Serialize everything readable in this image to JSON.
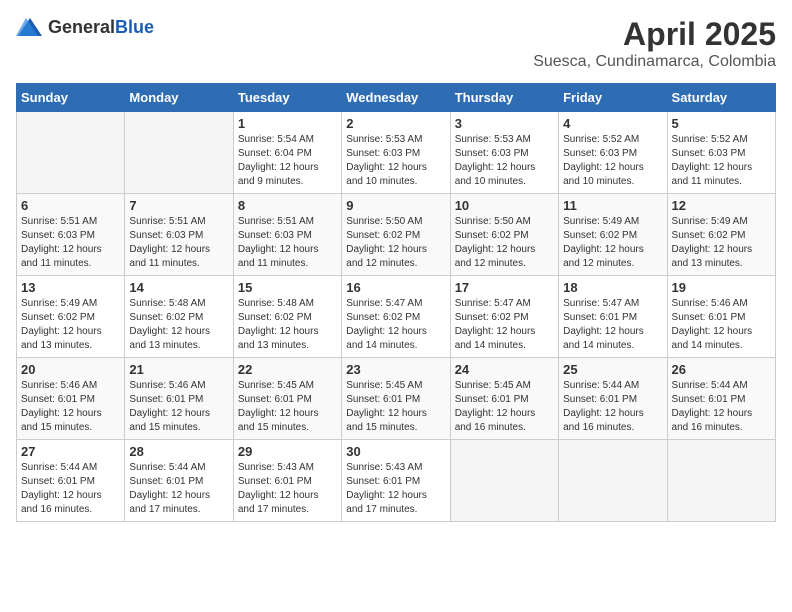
{
  "header": {
    "logo_general": "General",
    "logo_blue": "Blue",
    "month_title": "April 2025",
    "location": "Suesca, Cundinamarca, Colombia"
  },
  "days_of_week": [
    "Sunday",
    "Monday",
    "Tuesday",
    "Wednesday",
    "Thursday",
    "Friday",
    "Saturday"
  ],
  "weeks": [
    [
      {
        "day": "",
        "info": ""
      },
      {
        "day": "",
        "info": ""
      },
      {
        "day": "1",
        "info": "Sunrise: 5:54 AM\nSunset: 6:04 PM\nDaylight: 12 hours\nand 9 minutes."
      },
      {
        "day": "2",
        "info": "Sunrise: 5:53 AM\nSunset: 6:03 PM\nDaylight: 12 hours\nand 10 minutes."
      },
      {
        "day": "3",
        "info": "Sunrise: 5:53 AM\nSunset: 6:03 PM\nDaylight: 12 hours\nand 10 minutes."
      },
      {
        "day": "4",
        "info": "Sunrise: 5:52 AM\nSunset: 6:03 PM\nDaylight: 12 hours\nand 10 minutes."
      },
      {
        "day": "5",
        "info": "Sunrise: 5:52 AM\nSunset: 6:03 PM\nDaylight: 12 hours\nand 11 minutes."
      }
    ],
    [
      {
        "day": "6",
        "info": "Sunrise: 5:51 AM\nSunset: 6:03 PM\nDaylight: 12 hours\nand 11 minutes."
      },
      {
        "day": "7",
        "info": "Sunrise: 5:51 AM\nSunset: 6:03 PM\nDaylight: 12 hours\nand 11 minutes."
      },
      {
        "day": "8",
        "info": "Sunrise: 5:51 AM\nSunset: 6:03 PM\nDaylight: 12 hours\nand 11 minutes."
      },
      {
        "day": "9",
        "info": "Sunrise: 5:50 AM\nSunset: 6:02 PM\nDaylight: 12 hours\nand 12 minutes."
      },
      {
        "day": "10",
        "info": "Sunrise: 5:50 AM\nSunset: 6:02 PM\nDaylight: 12 hours\nand 12 minutes."
      },
      {
        "day": "11",
        "info": "Sunrise: 5:49 AM\nSunset: 6:02 PM\nDaylight: 12 hours\nand 12 minutes."
      },
      {
        "day": "12",
        "info": "Sunrise: 5:49 AM\nSunset: 6:02 PM\nDaylight: 12 hours\nand 13 minutes."
      }
    ],
    [
      {
        "day": "13",
        "info": "Sunrise: 5:49 AM\nSunset: 6:02 PM\nDaylight: 12 hours\nand 13 minutes."
      },
      {
        "day": "14",
        "info": "Sunrise: 5:48 AM\nSunset: 6:02 PM\nDaylight: 12 hours\nand 13 minutes."
      },
      {
        "day": "15",
        "info": "Sunrise: 5:48 AM\nSunset: 6:02 PM\nDaylight: 12 hours\nand 13 minutes."
      },
      {
        "day": "16",
        "info": "Sunrise: 5:47 AM\nSunset: 6:02 PM\nDaylight: 12 hours\nand 14 minutes."
      },
      {
        "day": "17",
        "info": "Sunrise: 5:47 AM\nSunset: 6:02 PM\nDaylight: 12 hours\nand 14 minutes."
      },
      {
        "day": "18",
        "info": "Sunrise: 5:47 AM\nSunset: 6:01 PM\nDaylight: 12 hours\nand 14 minutes."
      },
      {
        "day": "19",
        "info": "Sunrise: 5:46 AM\nSunset: 6:01 PM\nDaylight: 12 hours\nand 14 minutes."
      }
    ],
    [
      {
        "day": "20",
        "info": "Sunrise: 5:46 AM\nSunset: 6:01 PM\nDaylight: 12 hours\nand 15 minutes."
      },
      {
        "day": "21",
        "info": "Sunrise: 5:46 AM\nSunset: 6:01 PM\nDaylight: 12 hours\nand 15 minutes."
      },
      {
        "day": "22",
        "info": "Sunrise: 5:45 AM\nSunset: 6:01 PM\nDaylight: 12 hours\nand 15 minutes."
      },
      {
        "day": "23",
        "info": "Sunrise: 5:45 AM\nSunset: 6:01 PM\nDaylight: 12 hours\nand 15 minutes."
      },
      {
        "day": "24",
        "info": "Sunrise: 5:45 AM\nSunset: 6:01 PM\nDaylight: 12 hours\nand 16 minutes."
      },
      {
        "day": "25",
        "info": "Sunrise: 5:44 AM\nSunset: 6:01 PM\nDaylight: 12 hours\nand 16 minutes."
      },
      {
        "day": "26",
        "info": "Sunrise: 5:44 AM\nSunset: 6:01 PM\nDaylight: 12 hours\nand 16 minutes."
      }
    ],
    [
      {
        "day": "27",
        "info": "Sunrise: 5:44 AM\nSunset: 6:01 PM\nDaylight: 12 hours\nand 16 minutes."
      },
      {
        "day": "28",
        "info": "Sunrise: 5:44 AM\nSunset: 6:01 PM\nDaylight: 12 hours\nand 17 minutes."
      },
      {
        "day": "29",
        "info": "Sunrise: 5:43 AM\nSunset: 6:01 PM\nDaylight: 12 hours\nand 17 minutes."
      },
      {
        "day": "30",
        "info": "Sunrise: 5:43 AM\nSunset: 6:01 PM\nDaylight: 12 hours\nand 17 minutes."
      },
      {
        "day": "",
        "info": ""
      },
      {
        "day": "",
        "info": ""
      },
      {
        "day": "",
        "info": ""
      }
    ]
  ]
}
